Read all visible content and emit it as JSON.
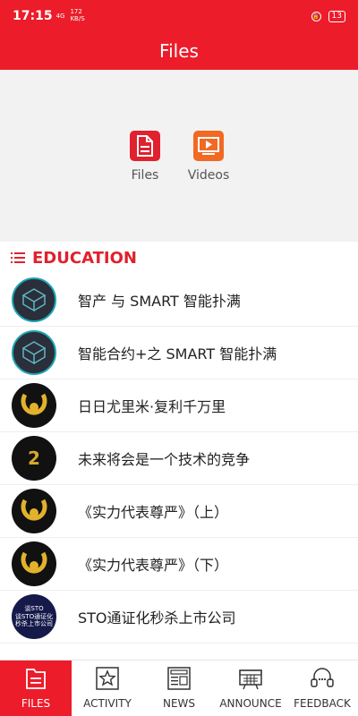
{
  "status_bar": {
    "time": "17:15",
    "signal": "4G",
    "speed_value": "172",
    "speed_unit": "KB/S",
    "battery": "13"
  },
  "header": {
    "title": "Files"
  },
  "hero": {
    "items": [
      {
        "label": "Files",
        "icon": "file-icon"
      },
      {
        "label": "Videos",
        "icon": "video-icon"
      }
    ]
  },
  "section": {
    "title": "EDUCATION",
    "icon": "list-icon"
  },
  "list": [
    {
      "label": "智产 与 SMART 智能扑满",
      "thumb": "cube"
    },
    {
      "label": "智能合约+之 SMART 智能扑满",
      "thumb": "cube"
    },
    {
      "label": "日日尤里米·复利千万里",
      "thumb": "horseshoe"
    },
    {
      "label": "未来将会是一个技术的竞争",
      "thumb": "hash"
    },
    {
      "label": "《实力代表尊严》（上）",
      "thumb": "horseshoe"
    },
    {
      "label": "《实力代表尊严》（下）",
      "thumb": "horseshoe"
    },
    {
      "label": "STO通证化秒杀上市公司",
      "thumb": "sto"
    }
  ],
  "thumb_text": {
    "hash_digit": "2",
    "sto_lines": [
      "谈STO",
      "谈STO通证化",
      "秒杀上市公司"
    ]
  },
  "bottom_nav": [
    {
      "label": "FILES",
      "icon": "folder-icon",
      "active": true
    },
    {
      "label": "ACTIVITY",
      "icon": "star-icon",
      "active": false
    },
    {
      "label": "NEWS",
      "icon": "newspaper-icon",
      "active": false
    },
    {
      "label": "ANNOUNCE",
      "icon": "megaphone-icon",
      "active": false
    },
    {
      "label": "FEEDBACK",
      "icon": "headset-icon",
      "active": false
    }
  ],
  "colors": {
    "brand_red": "#ec1c2a",
    "video_orange": "#f06a23"
  }
}
